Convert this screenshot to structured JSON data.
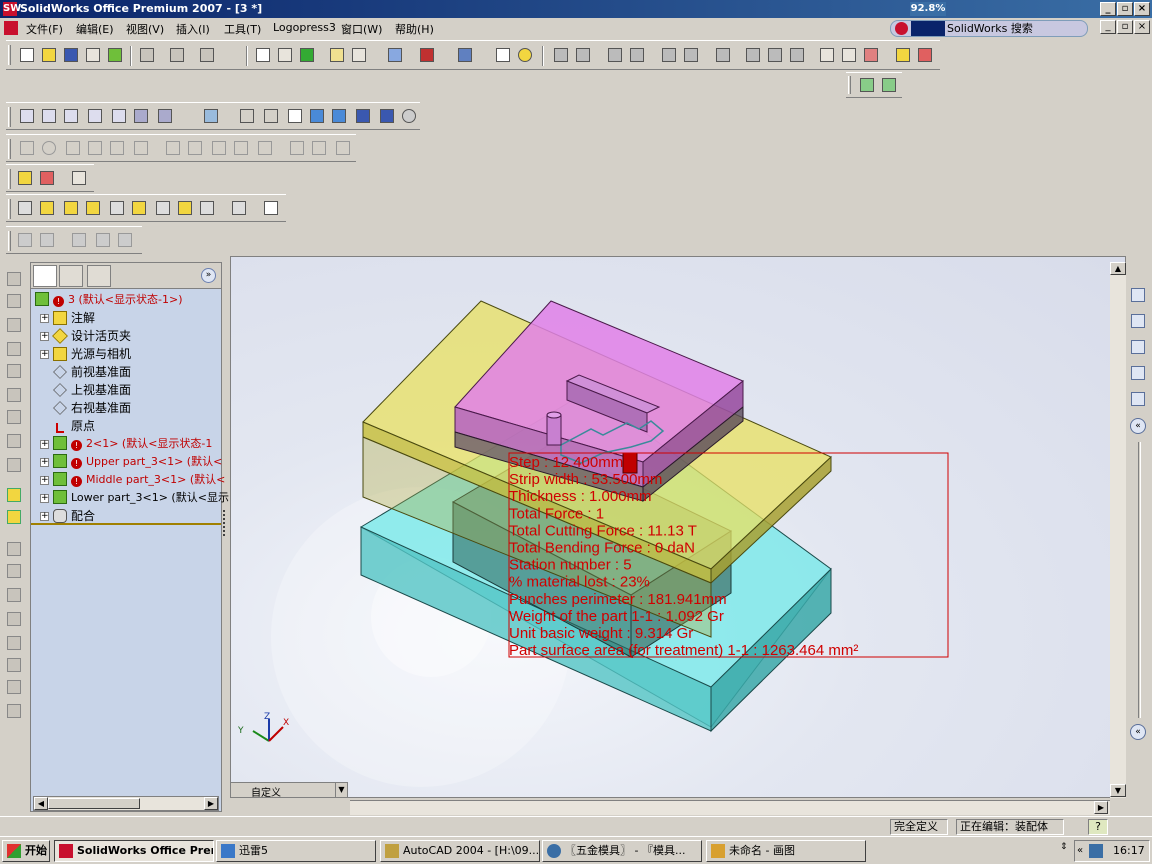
{
  "titlebar": {
    "title": "SolidWorks Office Premium 2007 - [3 *]",
    "logo": "SW",
    "progress_badge": "92.8%"
  },
  "menubar": {
    "items": [
      "文件(F)",
      "编辑(E)",
      "视图(V)",
      "插入(I)",
      "工具(T)",
      "Logopress3",
      "窗口(W)",
      "帮助(H)"
    ]
  },
  "search": {
    "label": "SolidWorks 搜索"
  },
  "featuremanager": {
    "root": "3 (默认<显示状态-1>)",
    "nodes": [
      "注解",
      "设计活页夹",
      "光源与相机",
      "前视基准面",
      "上视基准面",
      "右视基准面",
      "原点",
      "2<1> (默认<显示状态-1",
      "Upper part_3<1> (默认<",
      "Middle part_3<1> (默认<",
      "Lower part_3<1> (默认<显示",
      "配合"
    ]
  },
  "bottomtab": {
    "label": "自定义"
  },
  "annotation": {
    "lines": [
      "Step : 12.400mm",
      "Strip width : 53.500mm",
      "Thickness : 1.000mm",
      "Total Force : 1",
      "Total Cutting Force : 11.13 T",
      "Total Bending Force : 0 daN",
      "Station number : 5",
      "% material lost : 23%",
      "Punches perimeter : 181.941mm",
      "Weight of the part 1-1 : 1.092 Gr",
      "Unit basic weight : 9.314 Gr",
      "Part surface area (for treatment) 1-1 : 1263.464 mm²"
    ],
    "color": "#d00000"
  },
  "statusbar": {
    "state": "完全定义",
    "editing": "正在编辑：装配体",
    "help": "?"
  },
  "taskbar": {
    "start": "开始",
    "buttons": [
      "SolidWorks Office Premiu...",
      "迅雷5",
      "AutoCAD 2004 - [H:\\09...",
      "〖五金模具〗 - 『模具...",
      "未命名 - 画图"
    ],
    "clock": "16:17"
  },
  "colors": {
    "titlebar": "#0a246a",
    "tree_bg": "#c8d4e8",
    "plate_yellow": "#e8e060",
    "plate_cyan": "#70e8e8",
    "plate_magenta": "#e080e8"
  }
}
